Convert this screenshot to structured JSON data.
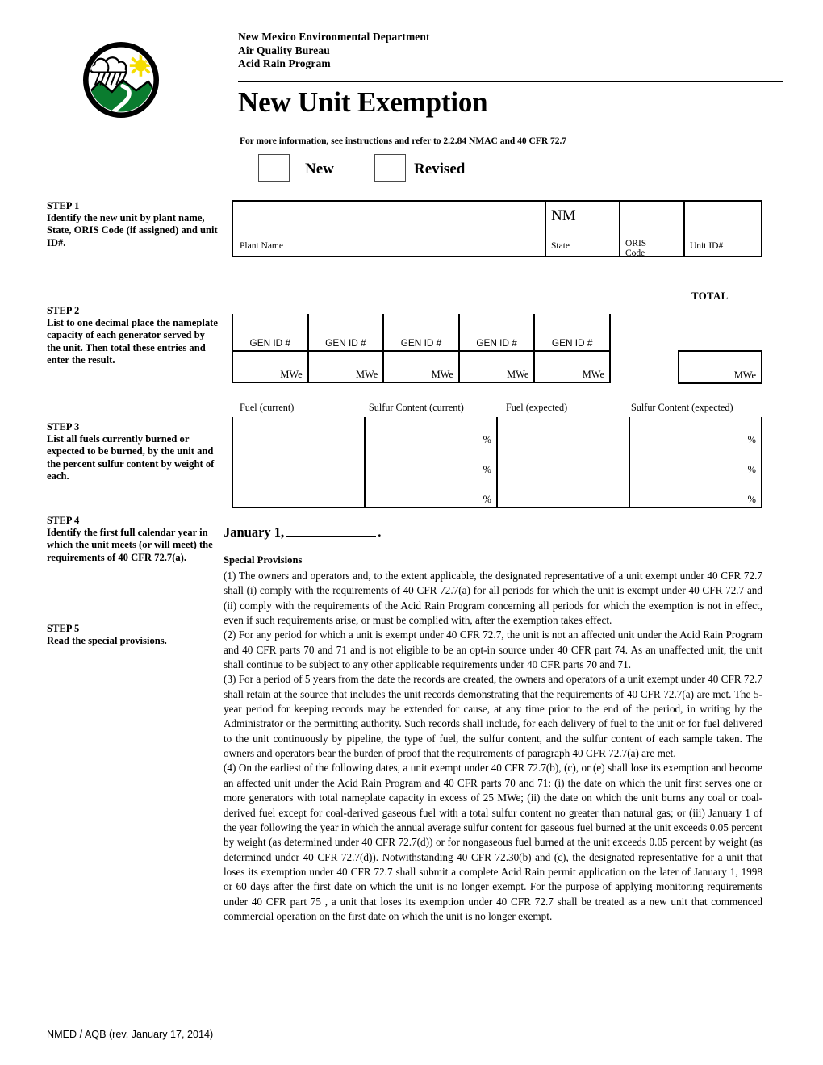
{
  "header": {
    "agency_line1": "New Mexico Environmental Department",
    "agency_line2": "Air Quality Bureau",
    "agency_line3": "Acid Rain Program",
    "title": "New Unit Exemption",
    "subtitle": "For more information, see instructions and refer to 2.2.84 NMAC and 40 CFR 72.7",
    "logo_name": "nmed-logo-icon",
    "logo_colors": {
      "ring": "#000000",
      "mountain": "#0a7c2f",
      "sun": "#f5dd00",
      "cloud": "#ffffff"
    }
  },
  "form_type": {
    "new_label": "New",
    "revised_label": "Revised",
    "new_checked": false,
    "revised_checked": false
  },
  "steps": {
    "step1": {
      "number": "STEP 1",
      "instruction": "Identify the new unit by plant name, State, ORIS Code (if assigned) and unit ID#.",
      "fields": [
        {
          "caption": "Plant Name",
          "value": ""
        },
        {
          "caption": "State",
          "value": "NM"
        },
        {
          "caption": "ORIS Code",
          "value": ""
        },
        {
          "caption": "Unit ID#",
          "value": ""
        }
      ]
    },
    "step2": {
      "number": "STEP 2",
      "instruction": "List to one decimal place the nameplate capacity of each generator served by the unit. Then total these entries and enter the result.",
      "total_label": "TOTAL",
      "gen_label": "GEN ID #",
      "unit_label": "MWe",
      "generators": [
        {
          "gen_id": "",
          "capacity": ""
        },
        {
          "gen_id": "",
          "capacity": ""
        },
        {
          "gen_id": "",
          "capacity": ""
        },
        {
          "gen_id": "",
          "capacity": ""
        },
        {
          "gen_id": "",
          "capacity": ""
        }
      ],
      "total_value": ""
    },
    "step3": {
      "number": "STEP 3",
      "instruction": "List all fuels currently burned or expected to be burned, by the unit and the percent sulfur content by weight of each.",
      "columns": [
        "Fuel (current)",
        "Sulfur Content (current)",
        "Fuel (expected)",
        "Sulfur Content (expected)"
      ],
      "percent_symbol": "%",
      "rows": [
        {
          "fuel_current": "",
          "sulfur_current": "",
          "fuel_expected": "",
          "sulfur_expected": ""
        },
        {
          "fuel_current": "",
          "sulfur_current": "",
          "fuel_expected": "",
          "sulfur_expected": ""
        },
        {
          "fuel_current": "",
          "sulfur_current": "",
          "fuel_expected": "",
          "sulfur_expected": ""
        }
      ]
    },
    "step4": {
      "number": "STEP 4",
      "instruction": "Identify the first full calendar year in which the unit meets (or will meet) the requirements of 40 CFR 72.7(a).",
      "date_prefix": "January 1,",
      "date_year_value": "",
      "date_suffix": "."
    },
    "step5": {
      "number": "STEP 5",
      "instruction": "Read the special provisions."
    }
  },
  "special_provisions": {
    "heading": "Special Provisions",
    "paragraphs": [
      "(1) The owners and operators and, to the extent applicable, the designated representative of a unit exempt under 40 CFR 72.7 shall (i) comply with the requirements of 40 CFR 72.7(a) for all periods for which the unit is exempt under 40 CFR 72.7 and (ii) comply with the requirements of the Acid Rain Program concerning all periods for which the exemption is not in effect, even if such requirements arise, or must be complied with, after the exemption takes effect.",
      "(2) For any period for which a unit is exempt under 40 CFR 72.7, the unit is not an affected unit under the Acid Rain Program and 40 CFR parts 70 and 71 and is not eligible to be an opt-in source under 40 CFR part 74.  As an unaffected unit, the unit shall continue to be subject to any other applicable requirements under 40 CFR parts 70 and 71.",
      "(3) For a period of 5 years from the date the records are created, the owners and operators of a unit exempt under 40 CFR 72.7 shall retain at the source that includes the unit records demonstrating that the requirements of 40 CFR 72.7(a) are met. The 5-year period for keeping records may be extended for cause, at any time prior to the end of the period, in writing by the Administrator or the permitting authority.  Such records shall include, for each delivery of fuel to the unit or for fuel delivered to the unit continuously by pipeline, the type of fuel, the sulfur content, and the sulfur content of each sample taken.  The owners and operators bear the burden of proof that the requirements of paragraph 40 CFR 72.7(a) are met.",
      "(4) On the earliest of the following dates, a unit exempt under 40 CFR 72.7(b), (c), or (e) shall lose its exemption and become an affected unit under the Acid Rain Program and 40 CFR parts 70 and 71: (i) the date on which the unit first serves one or more generators with total nameplate capacity in excess of 25 MWe; (ii) the date on which the unit burns any coal or coal-derived fuel except for coal-derived gaseous fuel with a total sulfur content no greater than natural gas; or (iii) January 1 of the year following the year in which the annual average sulfur content for gaseous fuel burned at the unit exceeds 0.05 percent by weight (as determined under 40 CFR 72.7(d)) or for nongaseous fuel burned at the unit exceeds 0.05 percent by weight (as determined under 40 CFR 72.7(d)).  Notwithstanding 40 CFR 72.30(b) and (c), the designated representative for a unit that loses its exemption under 40 CFR 72.7 shall submit a complete Acid Rain permit application on the later of January 1, 1998 or 60 days after the first date on which the unit is no longer exempt.  For the purpose of applying monitoring requirements under 40 CFR part 75 , a unit that loses its exemption under 40 CFR 72.7 shall be treated as a new unit that commenced commercial operation on the first date on which the unit is no longer exempt."
    ]
  },
  "footer": {
    "text": "NMED / AQB (rev. January 17, 2014)"
  }
}
